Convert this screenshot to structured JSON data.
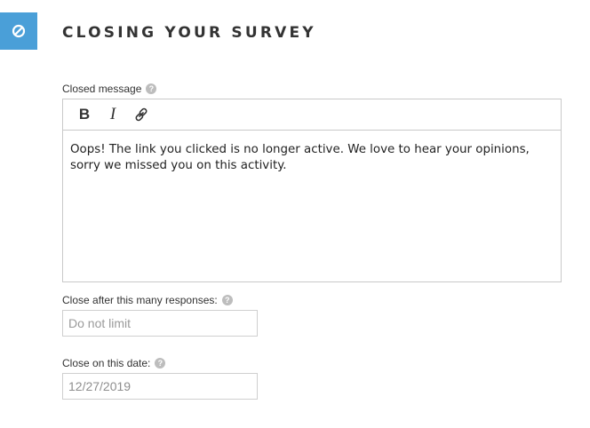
{
  "section": {
    "icon": "block-icon",
    "badge_color": "#4a9fd8",
    "title": "CLOSING YOUR SURVEY"
  },
  "closed_message": {
    "label": "Closed message",
    "toolbar": {
      "bold": "B",
      "italic": "I",
      "link_icon": "link-icon"
    },
    "text": "Oops! The link you clicked is no longer active. We love to hear your opinions, sorry we missed you on this activity."
  },
  "close_after": {
    "label": "Close after this many responses:",
    "value": "",
    "placeholder": "Do not limit"
  },
  "close_date": {
    "label": "Close on this date:",
    "value": "12/27/2019"
  },
  "help_glyph": "?"
}
